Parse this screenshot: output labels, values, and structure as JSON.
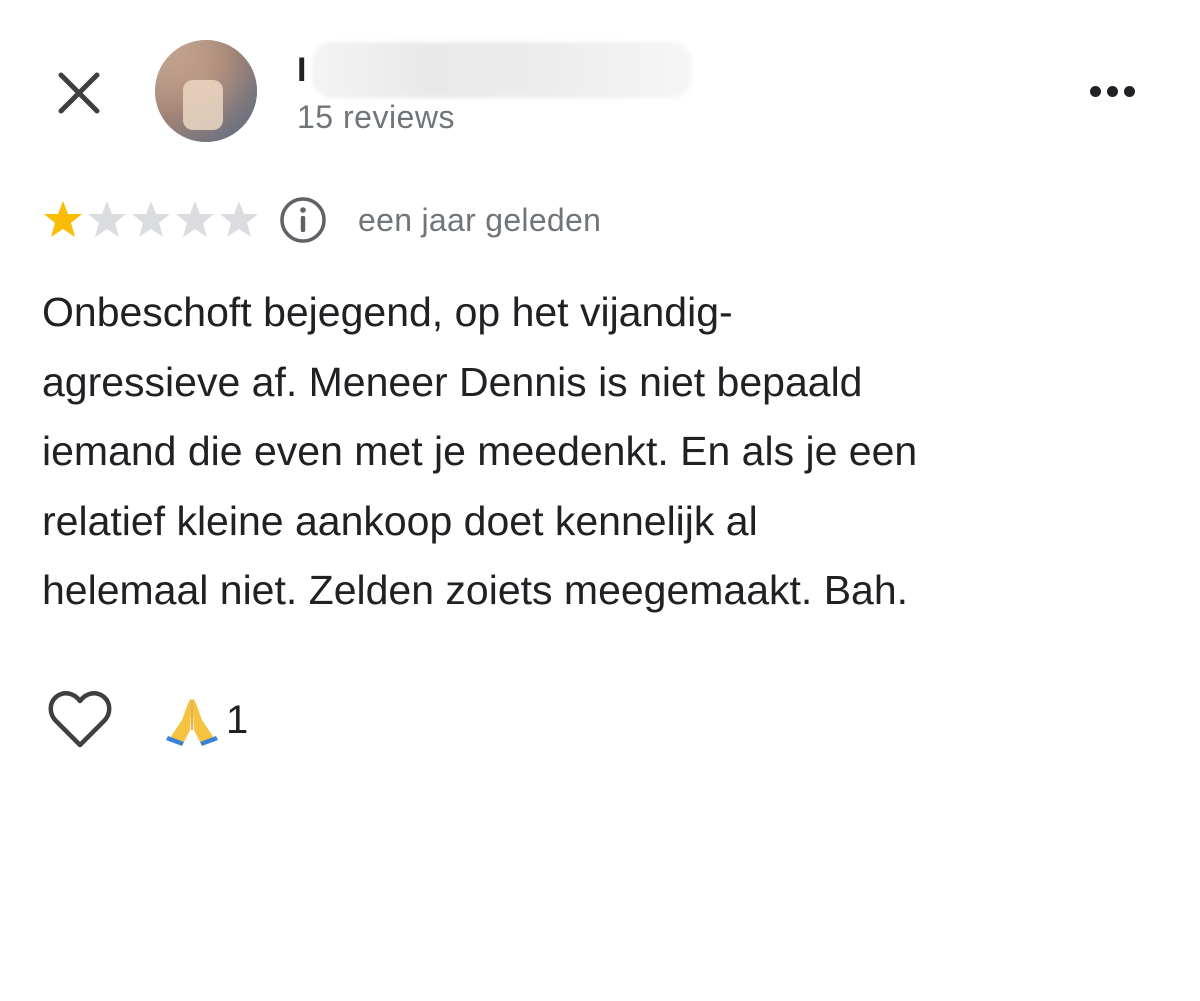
{
  "header": {
    "close_icon": "close-icon",
    "reviewer": {
      "name_visible_initial": "I",
      "reviews_count": "15 reviews"
    },
    "more_icon": "more-horizontal-icon"
  },
  "rating": {
    "stars_filled": 1,
    "stars_total": 5,
    "star_color": "#fbbc04",
    "star_empty_color": "#dadce0",
    "info_icon": "info-icon",
    "time_ago": "een jaar geleden"
  },
  "review": {
    "text": "Onbeschoft bejegend, op het vijandig-\nagressieve af. Meneer Dennis is niet bepaald\niemand die even met je meedenkt. En als je een\nrelatief kleine aankoop doet kennelijk al\nhelemaal niet. Zelden zoiets meegemaakt. Bah."
  },
  "reactions": {
    "like_icon": "heart-outline-icon",
    "items": [
      {
        "icon": "folded-hands-icon",
        "count": "1"
      }
    ]
  }
}
